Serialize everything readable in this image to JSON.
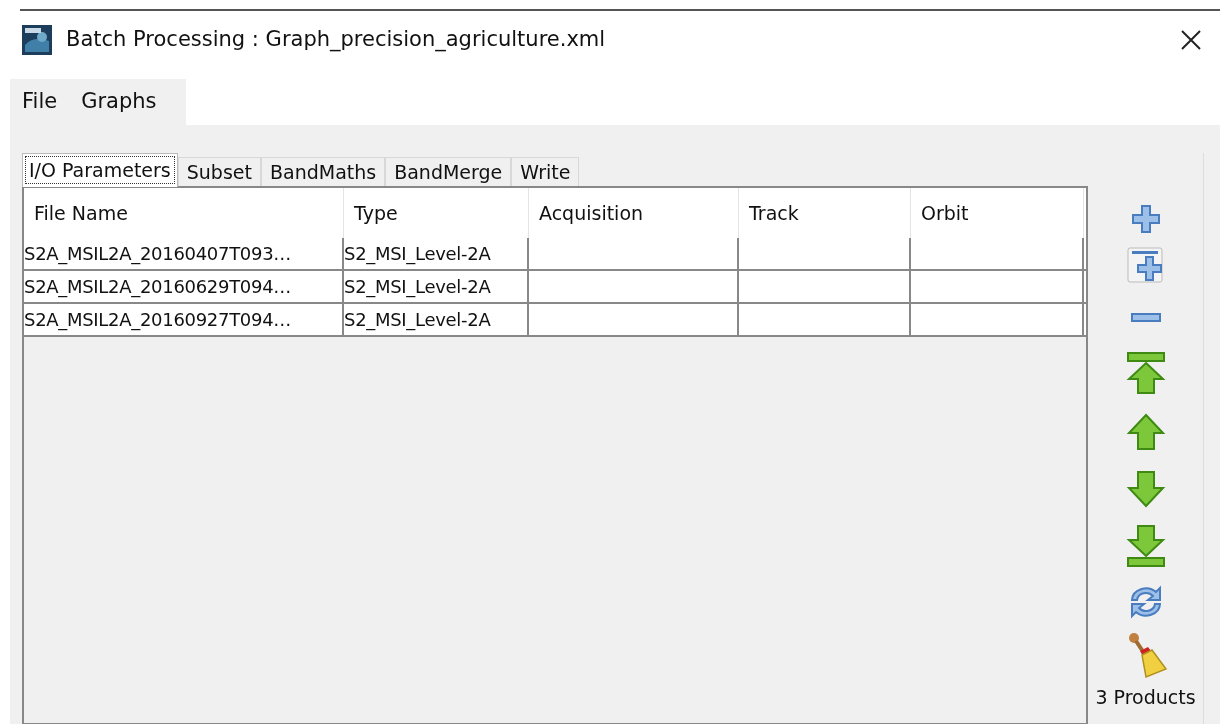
{
  "window": {
    "title": "Batch Processing : Graph_precision_agriculture.xml"
  },
  "menu": [
    "File",
    "Graphs"
  ],
  "tabs": [
    {
      "label": "I/O Parameters",
      "selected": true
    },
    {
      "label": "Subset",
      "selected": false
    },
    {
      "label": "BandMaths",
      "selected": false
    },
    {
      "label": "BandMerge",
      "selected": false
    },
    {
      "label": "Write",
      "selected": false
    }
  ],
  "table": {
    "columns": [
      "File Name",
      "Type",
      "Acquisition",
      "Track",
      "Orbit"
    ],
    "rows": [
      [
        "S2A_MSIL2A_20160407T093…",
        "S2_MSI_Level-2A"
      ],
      [
        "S2A_MSIL2A_20160629T094…",
        "S2_MSI_Level-2A"
      ],
      [
        "S2A_MSIL2A_20160927T094…",
        "S2_MSI_Level-2A"
      ]
    ]
  },
  "product_count": "3 Products"
}
